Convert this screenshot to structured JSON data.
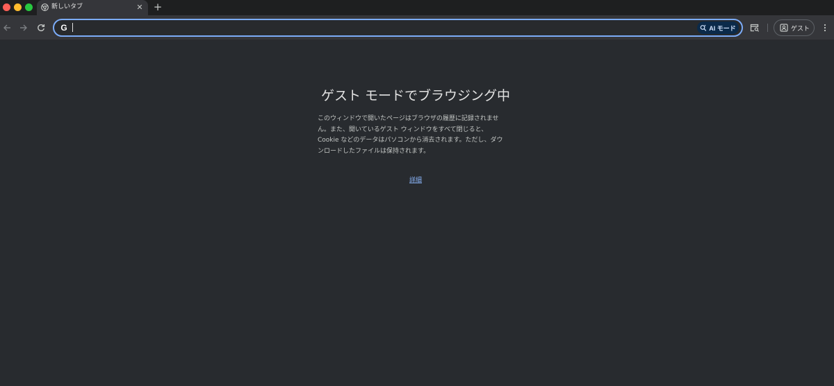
{
  "window": {
    "controls": [
      "close",
      "minimize",
      "maximize"
    ]
  },
  "tab": {
    "title": "新しいタブ",
    "favicon": "chrome-icon",
    "close_icon": "close-icon"
  },
  "new_tab": {
    "icon": "plus-icon",
    "label": "+"
  },
  "toolbar": {
    "back_icon": "arrow-left-icon",
    "forward_icon": "arrow-right-icon",
    "reload_icon": "reload-icon",
    "omnibox": {
      "search_engine_icon": "google-g-icon",
      "search_engine_label": "G",
      "value": "",
      "ai_mode_label": "AI モード",
      "ai_mode_icon": "ai-search-icon"
    },
    "tab_search_icon": "tab-search-icon",
    "profile": {
      "icon": "guest-profile-icon",
      "label": "ゲスト"
    },
    "menu_icon": "more-vert-icon"
  },
  "content": {
    "title": "ゲスト モードでブラウジング中",
    "description_lines": [
      "このウィンドウで開いたページはブラウザの履歴に記録されませ",
      "ん。また、開いているゲスト ウィンドウをすべて閉じると、",
      "Cookie などのデータはパソコンから消去されます。ただし、ダウ",
      "ンロードしたファイルは保持されます。"
    ],
    "learn_more": "詳細"
  },
  "colors": {
    "tabstrip_bg": "#1e1f20",
    "toolbar_bg": "#35363a",
    "content_bg": "#282b2f",
    "omnibox_focus": "#7cacf8",
    "link": "#8ab4f8",
    "ai_mode_bg": "#0b2a4a"
  }
}
